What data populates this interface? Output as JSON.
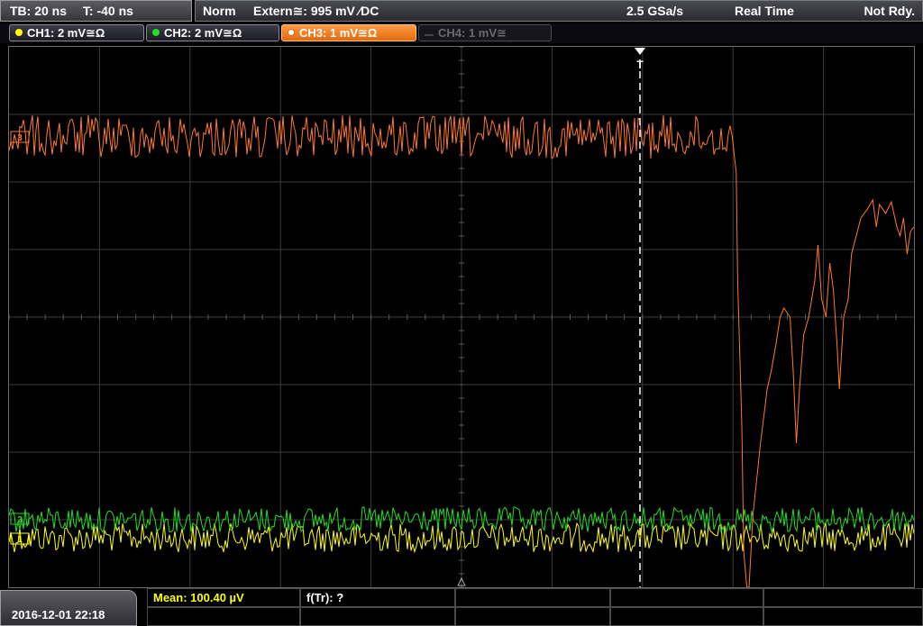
{
  "top_bar": {
    "timebase": "TB: 20 ns",
    "trigger_offset": "T: -40 ns",
    "mode": "Norm",
    "trigger_source": "Extern≅: 995 mV ∕DC",
    "sample_rate": "2.5 GSa/s",
    "acquisition": "Real Time",
    "status": "Not Rdy."
  },
  "channels": [
    {
      "label": "CH1: 2 mV≅Ω",
      "color": "#ffff00",
      "active": false
    },
    {
      "label": "CH2: 2 mV≅Ω",
      "color": "#22dd22",
      "active": false
    },
    {
      "label": "CH3: 1 mV≅Ω",
      "color": "#ff8a30",
      "active": true
    },
    {
      "label": "CH4: 1 mV≅",
      "color": "#555555",
      "active": false
    }
  ],
  "markers": {
    "ch3_ref": "3",
    "ch2_ref": "2",
    "ch1_ref": "1",
    "trigger": "T"
  },
  "bottom": {
    "datetime": "2016-12-01 22:18",
    "measurement_mean": "Mean: 100.40 µV",
    "measurement_ftr": "f(Tr): ?"
  },
  "colors": {
    "ch1": "#ffff00",
    "ch2": "#22dd22",
    "ch3": "#ff7a2a",
    "grid": "#3c3c3c",
    "trigger_line": "#ffffff"
  }
}
